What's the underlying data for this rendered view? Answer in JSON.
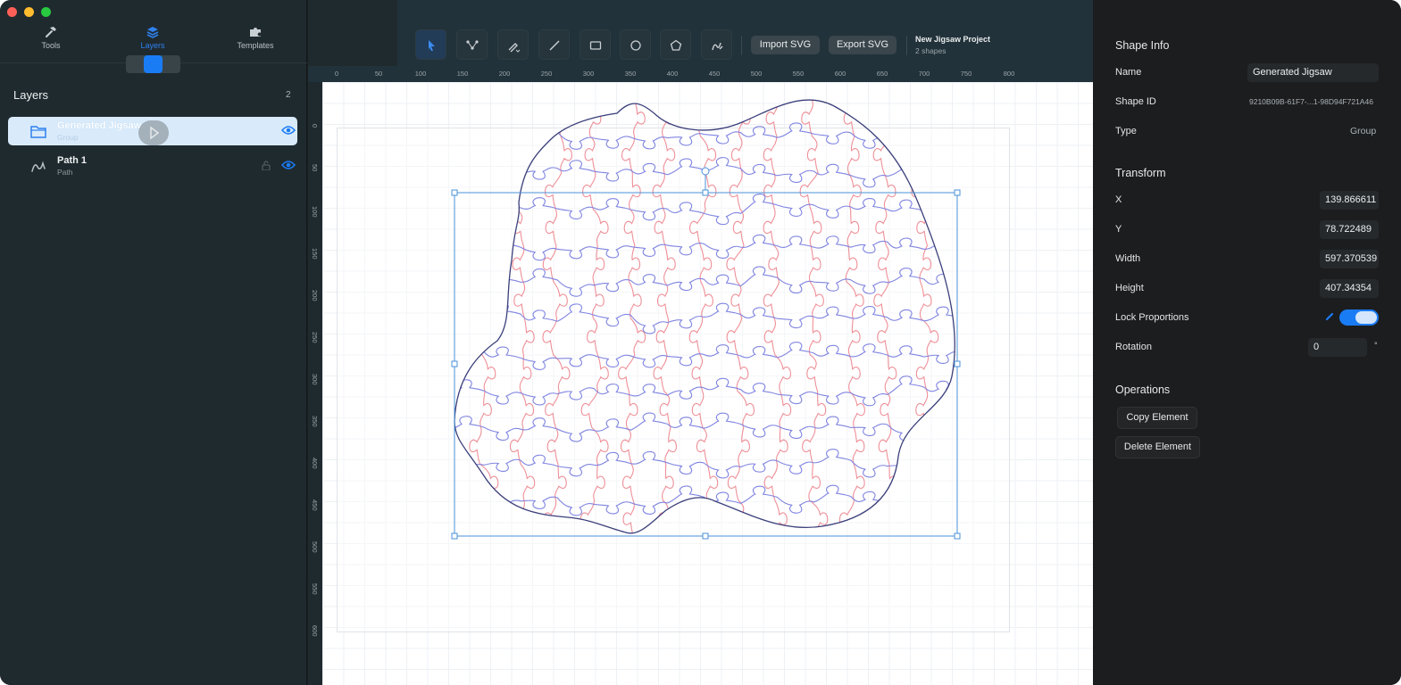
{
  "window": {
    "traffic_lights": [
      "close",
      "minimize",
      "zoom"
    ]
  },
  "sidebar": {
    "tabs": [
      {
        "label": "Tools",
        "icon": "hammer-icon"
      },
      {
        "label": "Layers",
        "icon": "layers-icon",
        "active": true
      },
      {
        "label": "Templates",
        "icon": "puzzle-icon"
      }
    ],
    "layers_title": "Layers",
    "layers_count": "2",
    "layers": [
      {
        "name": "Generated Jigsaw",
        "type": "Group",
        "icon": "folder-icon",
        "selected": true,
        "visible": true
      },
      {
        "name": "Path 1",
        "type": "Path",
        "icon": "path-icon",
        "visible": true,
        "locked": false
      }
    ]
  },
  "toolbar": {
    "tools": [
      "select-tool",
      "node-tool",
      "pen-tool",
      "line-tool",
      "rectangle-tool",
      "ellipse-tool",
      "polygon-tool",
      "freehand-tool"
    ],
    "active_tool": "select-tool",
    "import_label": "Import SVG",
    "export_label": "Export SVG",
    "project_name": "New Jigsaw Project",
    "project_shapes": "2 shapes"
  },
  "rulers": {
    "top": [
      "0",
      "50",
      "100",
      "150",
      "200",
      "250",
      "300",
      "350",
      "400",
      "450",
      "500",
      "550",
      "600",
      "650",
      "700",
      "750",
      "800"
    ],
    "left": [
      "0",
      "50",
      "100",
      "150",
      "200",
      "250",
      "300",
      "350",
      "400",
      "450",
      "500",
      "550",
      "600"
    ]
  },
  "inspector": {
    "shape_info_title": "Shape Info",
    "name_label": "Name",
    "name_value": "Generated Jigsaw",
    "id_label": "Shape ID",
    "id_value": "9210B09B-61F7-...1-98D94F721A46",
    "type_label": "Type",
    "type_value": "Group",
    "transform_title": "Transform",
    "x_label": "X",
    "x_value": "139.866611",
    "y_label": "Y",
    "y_value": "78.722489",
    "width_label": "Width",
    "width_value": "597.370539",
    "height_label": "Height",
    "height_value": "407.34354",
    "lock_label": "Lock Proportions",
    "lock_enabled": true,
    "rotation_label": "Rotation",
    "rotation_value": "0",
    "rotation_unit": "°",
    "operations_title": "Operations",
    "copy_label": "Copy Element",
    "delete_label": "Delete Element"
  },
  "colors": {
    "accent": "#1a7cf5",
    "outline": "#3b3f7a",
    "cut_blue": "#7f84e0",
    "cut_red": "#ee8f97",
    "selection": "#4a90d9"
  }
}
